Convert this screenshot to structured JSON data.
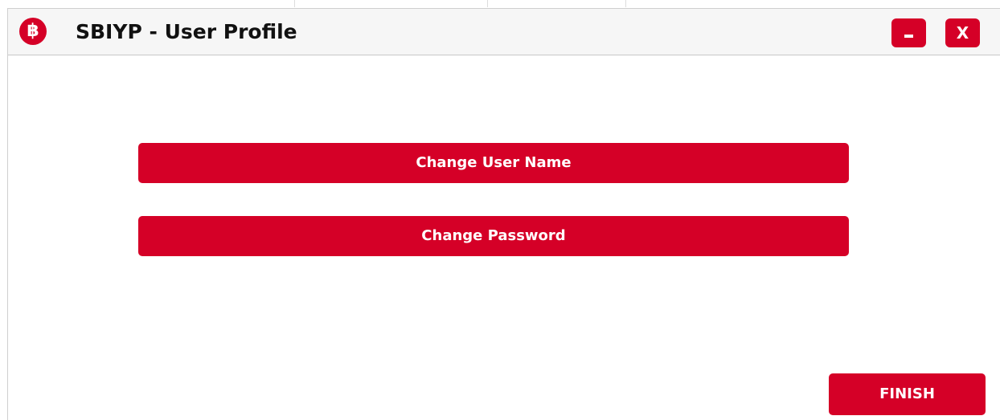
{
  "window": {
    "app_icon_glyph": "฿",
    "title": "SBIYP - User Profile",
    "minimize_icon": "minimize-icon",
    "close_label": "X"
  },
  "actions": {
    "change_username_label": "Change User Name",
    "change_password_label": "Change Password",
    "finish_label": "FINISH"
  },
  "colors": {
    "accent": "#d50027",
    "titlebar_bg": "#f6f6f6",
    "window_bg": "#ffffff"
  }
}
